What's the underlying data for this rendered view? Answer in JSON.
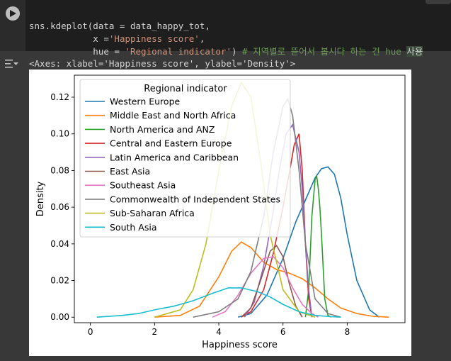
{
  "code_lines": [
    {
      "a": "sns.kdeplot(data = data_happy_tot,"
    },
    {
      "a": "            x =",
      "s": "'Happiness score'",
      "b": ","
    },
    {
      "a": "            hue = ",
      "s": "'Regional indicator'",
      "b": ") ",
      "c": "# 지역별로 뜯어서 봅시다 하는 건 hue ",
      "h": "사용"
    }
  ],
  "output_text": "<Axes: xlabel='Happiness score', ylabel='Density'>",
  "chart_data": {
    "type": "line",
    "xlabel": "Happiness score",
    "ylabel": "Density",
    "xlim": [
      -0.5,
      9.8
    ],
    "ylim": [
      -0.003,
      0.132
    ],
    "xticks": [
      0,
      2,
      4,
      6,
      8
    ],
    "yticks": [
      0.0,
      0.02,
      0.04,
      0.06,
      0.08,
      0.1,
      0.12
    ],
    "ytick_labels": [
      "0.00",
      "0.02",
      "0.04",
      "0.06",
      "0.08",
      "0.10",
      "0.12"
    ],
    "legend_title": "Regional indicator",
    "legend_position": "upper-left",
    "series": [
      {
        "name": "Western Europe",
        "color": "#1f77b4",
        "x": [
          4.6,
          5.0,
          5.5,
          6.0,
          6.4,
          6.8,
          7.0,
          7.2,
          7.4,
          7.6,
          7.8,
          8.0,
          8.3,
          8.7,
          9.0
        ],
        "y": [
          0.0,
          0.002,
          0.012,
          0.032,
          0.052,
          0.068,
          0.076,
          0.081,
          0.082,
          0.078,
          0.065,
          0.045,
          0.02,
          0.004,
          0.0
        ]
      },
      {
        "name": "Middle East and North Africa",
        "color": "#ff7f0e",
        "x": [
          2.0,
          2.8,
          3.4,
          4.0,
          4.4,
          4.7,
          5.0,
          5.4,
          5.8,
          6.2,
          6.6,
          7.0,
          7.4,
          7.8,
          8.3,
          8.8,
          9.3
        ],
        "y": [
          0.0,
          0.001,
          0.006,
          0.022,
          0.036,
          0.041,
          0.038,
          0.03,
          0.026,
          0.024,
          0.021,
          0.016,
          0.01,
          0.005,
          0.002,
          0.0005,
          0.0
        ]
      },
      {
        "name": "North America and ANZ",
        "color": "#2ca02c",
        "x": [
          6.7,
          6.8,
          6.9,
          7.0,
          7.05,
          7.1,
          7.15,
          7.2,
          7.3,
          7.4,
          7.5
        ],
        "y": [
          0.0,
          0.015,
          0.055,
          0.075,
          0.077,
          0.07,
          0.06,
          0.045,
          0.01,
          0.001,
          0.0
        ]
      },
      {
        "name": "Central and Eastern Europe",
        "color": "#d62728",
        "x": [
          4.7,
          5.0,
          5.4,
          5.7,
          6.0,
          6.2,
          6.35,
          6.5,
          6.6,
          6.7,
          6.8,
          6.9
        ],
        "y": [
          0.0,
          0.003,
          0.015,
          0.035,
          0.06,
          0.079,
          0.094,
          0.1,
          0.08,
          0.04,
          0.01,
          0.0
        ]
      },
      {
        "name": "Latin America and Caribbean",
        "color": "#9467bd",
        "x": [
          4.8,
          5.1,
          5.4,
          5.7,
          5.9,
          6.1,
          6.3,
          6.5,
          6.6,
          6.7,
          6.8,
          6.9
        ],
        "y": [
          0.0,
          0.008,
          0.028,
          0.058,
          0.082,
          0.1,
          0.105,
          0.09,
          0.07,
          0.04,
          0.015,
          0.0
        ]
      },
      {
        "name": "East Asia",
        "color": "#8c564b",
        "x": [
          4.7,
          5.0,
          5.3,
          5.6,
          5.8,
          6.0,
          6.2,
          6.4,
          6.6
        ],
        "y": [
          0.0,
          0.005,
          0.02,
          0.036,
          0.039,
          0.033,
          0.018,
          0.006,
          0.0
        ]
      },
      {
        "name": "Southeast Asia",
        "color": "#e377c2",
        "x": [
          3.8,
          4.2,
          4.6,
          5.0,
          5.4,
          5.7,
          6.0,
          6.3,
          6.6,
          6.9,
          7.1
        ],
        "y": [
          0.0,
          0.003,
          0.012,
          0.024,
          0.032,
          0.033,
          0.027,
          0.016,
          0.007,
          0.002,
          0.0
        ]
      },
      {
        "name": "Commonwealth of Independent States",
        "color": "#7f7f7f",
        "x": [
          3.2,
          4.0,
          4.6,
          5.0,
          5.4,
          5.7,
          6.0,
          6.15,
          6.3,
          6.5,
          6.7,
          7.0,
          7.4,
          7.8
        ],
        "y": [
          0.0,
          0.003,
          0.01,
          0.025,
          0.055,
          0.09,
          0.115,
          0.119,
          0.11,
          0.08,
          0.04,
          0.01,
          0.002,
          0.0
        ]
      },
      {
        "name": "Sub-Saharan Africa",
        "color": "#bcbd22",
        "x": [
          2.0,
          2.8,
          3.2,
          3.6,
          4.0,
          4.4,
          4.7,
          5.0,
          5.3,
          5.6,
          6.0,
          6.5,
          7.0
        ],
        "y": [
          0.0,
          0.004,
          0.015,
          0.04,
          0.08,
          0.115,
          0.128,
          0.12,
          0.085,
          0.045,
          0.015,
          0.003,
          0.0
        ]
      },
      {
        "name": "South Asia",
        "color": "#17becf",
        "x": [
          0.2,
          1.0,
          1.5,
          2.0,
          2.6,
          3.2,
          3.8,
          4.3,
          4.7,
          5.2,
          5.6,
          6.0,
          6.5,
          7.0,
          7.5,
          7.8
        ],
        "y": [
          0.0,
          0.001,
          0.002,
          0.004,
          0.006,
          0.009,
          0.013,
          0.016,
          0.016,
          0.014,
          0.011,
          0.007,
          0.003,
          0.001,
          0.0003,
          0.0
        ]
      }
    ]
  }
}
